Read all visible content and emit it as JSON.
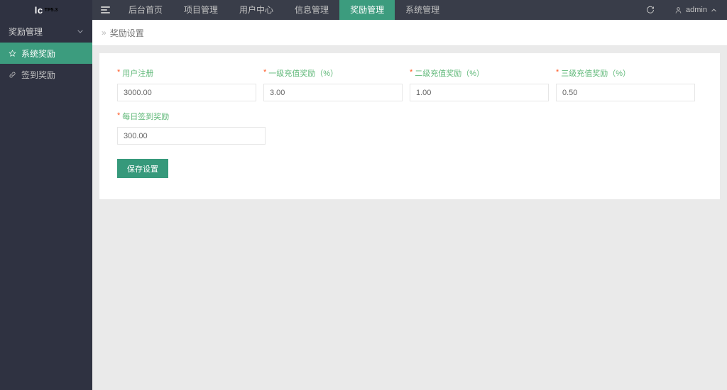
{
  "logo": {
    "text": "lc",
    "sup": "TP5.3"
  },
  "header": {
    "menu_icon": "hamburger-icon",
    "nav": [
      {
        "label": "后台首页",
        "active": false
      },
      {
        "label": "项目管理",
        "active": false
      },
      {
        "label": "用户中心",
        "active": false
      },
      {
        "label": "信息管理",
        "active": false
      },
      {
        "label": "奖励管理",
        "active": true
      },
      {
        "label": "系统管理",
        "active": false
      }
    ],
    "refresh_icon": "refresh-icon",
    "user_icon": "user-icon",
    "user_name": "admin",
    "user_chevron": "chevron-up-icon"
  },
  "sidebar": {
    "group_title": "奖励管理",
    "group_chevron": "chevron-down-icon",
    "items": [
      {
        "label": "系统奖励",
        "icon": "star-icon",
        "active": true
      },
      {
        "label": "签到奖励",
        "icon": "link-icon",
        "active": false
      }
    ]
  },
  "breadcrumb": {
    "separator": "»",
    "current": "奖励设置"
  },
  "form": {
    "fields_row1": [
      {
        "label": "用户注册",
        "value": "3000.00",
        "required": true
      },
      {
        "label": "一级充值奖励（%）",
        "value": "3.00",
        "required": true
      },
      {
        "label": "二级充值奖励（%）",
        "value": "1.00",
        "required": true
      },
      {
        "label": "三级充值奖励（%）",
        "value": "0.50",
        "required": true
      }
    ],
    "fields_row2": [
      {
        "label": "每日签到奖励",
        "value": "300.00",
        "required": true
      }
    ],
    "save_label": "保存设置"
  },
  "colors": {
    "accent": "#3c9c7e",
    "button": "#36997b",
    "sidebar_bg": "#2f3241",
    "header_bg": "#393D49",
    "label_green": "#5FB878",
    "required_red": "#FF5722",
    "page_bg": "#eaeaea"
  }
}
